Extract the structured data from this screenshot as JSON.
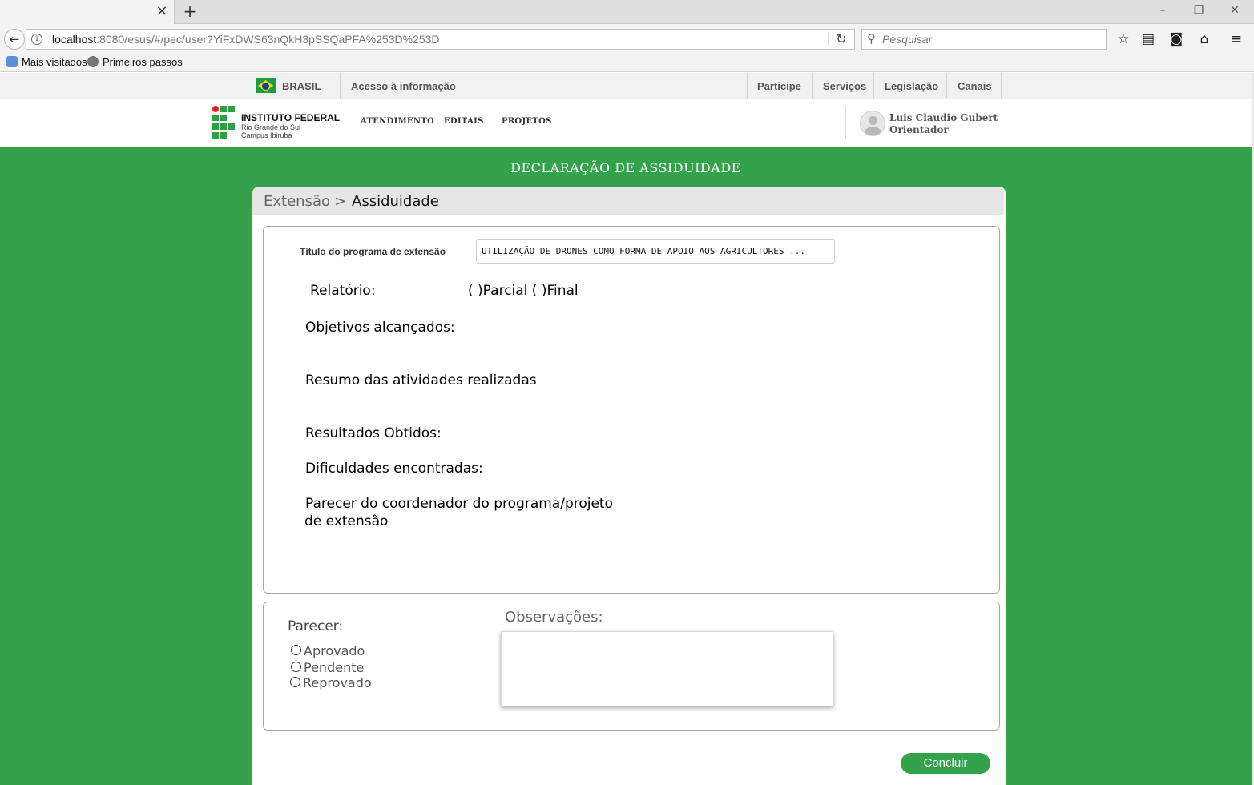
{
  "browser": {
    "url_host": "localhost",
    "url_rest": ":8080/esus/#/pec/user?YiFxDWS63nQkH3pSSQaPFA%253D%253D",
    "search_placeholder": "Pesquisar",
    "bookmarks": [
      "Mais visitados",
      "Primeiros passos"
    ],
    "icons": [
      "back-arrow-icon",
      "info-icon",
      "reload-icon",
      "search-icon",
      "star-icon",
      "reading-list-icon",
      "pocket-icon",
      "home-icon",
      "menu-icon"
    ]
  },
  "govbar": {
    "brasil": "BRASIL",
    "acesso": "Acesso à informação",
    "links": [
      "Participe",
      "Serviços",
      "Legislação",
      "Canais"
    ]
  },
  "header": {
    "logo_title": "INSTITUTO FEDERAL",
    "logo_sub1": "Rio Grande do Sul",
    "logo_sub2": "Campus Ibirubá",
    "menu": [
      "ATENDIMENTO",
      "EDITAIS",
      "PROJETOS"
    ],
    "user_name": "Luis Claudio Gubert",
    "user_role": "Orientador"
  },
  "page": {
    "title": "DECLARAÇÃO DE ASSIDUIDADE",
    "breadcrumb": [
      "Extensão",
      "Assiduidade"
    ],
    "breadcrumb_sep": ">"
  },
  "form": {
    "program_label": "Título do programa de extensão",
    "program_value": "UTILIZAÇÃO DE DRONES COMO FORMA DE APOIO AOS AGRICULTORES ...",
    "relatorio_label": "Relatório:",
    "relatorio_options": "( )Parcial ( )Final",
    "objetivos": "Objetivos alcançados:",
    "resumo": "Resumo das atividades realizadas",
    "resultados": "Resultados Obtidos:",
    "dificuldades": "Dificuldades encontradas:",
    "parecer_coord_1": "Parecer do coordenador do programa/projeto",
    "parecer_coord_2": "de extensão"
  },
  "review": {
    "parecer_label": "Parecer:",
    "options": [
      "Aprovado",
      "Pendente",
      "Reprovado"
    ],
    "observacoes_label": "Observações:",
    "observacoes_value": ""
  },
  "actions": {
    "concluir": "Concluir"
  },
  "colors": {
    "brand_green": "#33a24a",
    "ifrs_red": "#e21e26"
  }
}
